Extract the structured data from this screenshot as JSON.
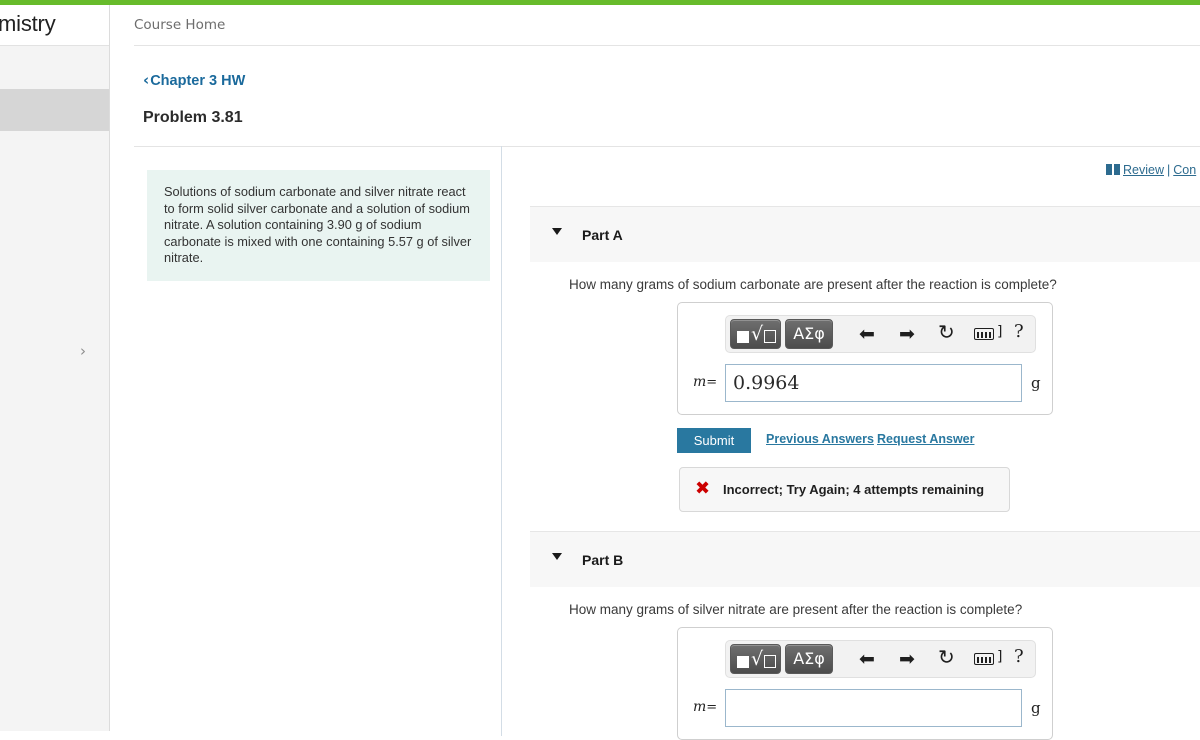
{
  "theme": {
    "accent_green": "#67bb2b",
    "link_blue": "#2978a0",
    "back_link_blue": "#1b6a9c",
    "statement_bg": "#e9f4f1",
    "error_red": "#cc0000",
    "part_header_bg": "#f7f7f7"
  },
  "sidebar": {
    "brand": "emistry",
    "chevron_icon": "›"
  },
  "header": {
    "breadcrumb": "Course Home",
    "back_chevron": "‹",
    "back_label": "Chapter 3 HW",
    "problem_title": "Problem 3.81"
  },
  "review": {
    "review_label": "Review",
    "separator": "|",
    "constants_label": "Con"
  },
  "statement": {
    "text": "Solutions of sodium carbonate and silver nitrate react to form solid silver carbonate and a solution of sodium nitrate. A solution containing 3.90 g of sodium carbonate is mixed with one containing 5.57 g of silver nitrate."
  },
  "mathbar": {
    "template_label": "√",
    "greek_label": "ΑΣφ",
    "undo_icon": "⬅",
    "redo_icon": "➡",
    "reset_icon": "↻",
    "bracket_label": "]",
    "help_label": "?"
  },
  "parts": [
    {
      "id": "a",
      "label": "Part A",
      "question": "How many grams of sodium carbonate are present after the reaction is complete?",
      "variable": "m",
      "equals": "=",
      "value": "0.9964",
      "placeholder": "",
      "unit": "g"
    },
    {
      "id": "b",
      "label": "Part B",
      "question": "How many grams of silver nitrate are present after the reaction is complete?",
      "variable": "m",
      "equals": "=",
      "value": "",
      "placeholder": "",
      "unit": "g"
    }
  ],
  "actions": {
    "submit_label": "Submit",
    "previous_answers_label": "Previous Answers",
    "request_answer_label": "Request Answer"
  },
  "feedback": {
    "icon": "✖",
    "text": "Incorrect; Try Again; 4 attempts remaining"
  }
}
